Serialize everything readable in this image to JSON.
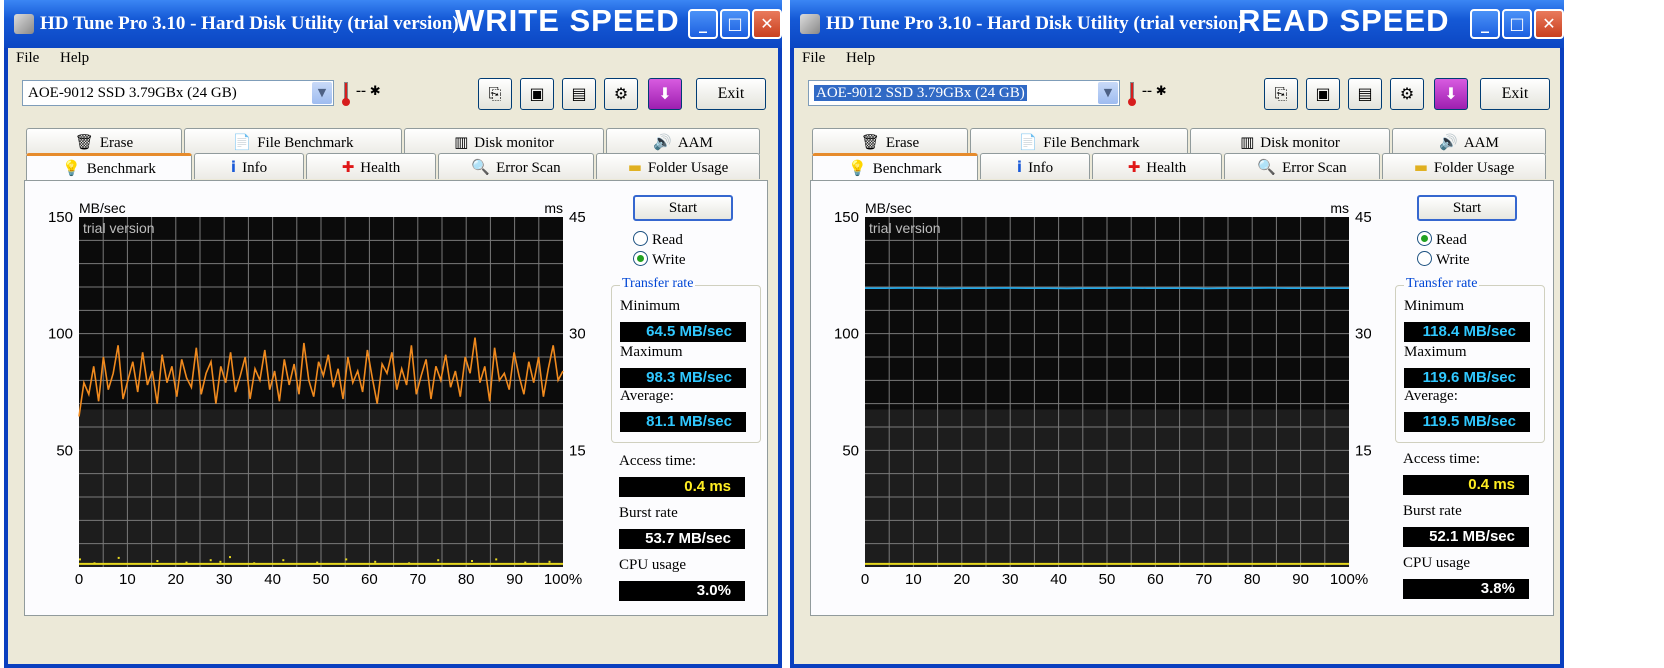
{
  "windows": [
    {
      "title": "HD Tune Pro 3.10 - Hard Disk Utility (trial version)",
      "overlay_label": "WRITE SPEED",
      "menu": [
        "File",
        "Help"
      ],
      "drive": "AOE-9012 SSD 3.79GBx (24 GB)",
      "temperature": "--",
      "exit_label": "Exit",
      "tabs_top": [
        "Erase",
        "File Benchmark",
        "Disk monitor",
        "AAM"
      ],
      "tabs_bottom": [
        "Benchmark",
        "Info",
        "Health",
        "Error Scan",
        "Folder Usage"
      ],
      "start_label": "Start",
      "radio_read": "Read",
      "radio_write": "Write",
      "selected_mode": "Write",
      "transfer_rate_title": "Transfer rate",
      "min_label": "Minimum",
      "min_value": "64.5 MB/sec",
      "max_label": "Maximum",
      "max_value": "98.3 MB/sec",
      "avg_label": "Average:",
      "avg_value": "81.1 MB/sec",
      "access_label": "Access time:",
      "access_value": "0.4 ms",
      "burst_label": "Burst rate",
      "burst_value": "53.7 MB/sec",
      "cpu_label": "CPU usage",
      "cpu_value": "3.0%"
    },
    {
      "title": "HD Tune Pro 3.10 - Hard Disk Utility (trial version)",
      "overlay_label": "READ SPEED",
      "menu": [
        "File",
        "Help"
      ],
      "drive": "AOE-9012 SSD 3.79GBx (24 GB)",
      "temperature": "--",
      "exit_label": "Exit",
      "tabs_top": [
        "Erase",
        "File Benchmark",
        "Disk monitor",
        "AAM"
      ],
      "tabs_bottom": [
        "Benchmark",
        "Info",
        "Health",
        "Error Scan",
        "Folder Usage"
      ],
      "start_label": "Start",
      "radio_read": "Read",
      "radio_write": "Write",
      "selected_mode": "Read",
      "transfer_rate_title": "Transfer rate",
      "min_label": "Minimum",
      "min_value": "118.4 MB/sec",
      "max_label": "Maximum",
      "max_value": "119.6 MB/sec",
      "avg_label": "Average:",
      "avg_value": "119.5 MB/sec",
      "access_label": "Access time:",
      "access_value": "0.4 ms",
      "burst_label": "Burst rate",
      "burst_value": "52.1 MB/sec",
      "cpu_label": "CPU usage",
      "cpu_value": "3.8%"
    }
  ],
  "chart_data": [
    {
      "type": "line",
      "watermark": "trial version",
      "ylabel": "MB/sec",
      "y2label": "ms",
      "ylim": [
        0,
        150
      ],
      "y2lim": [
        0,
        45
      ],
      "yticks": [
        50,
        100,
        150
      ],
      "y2ticks": [
        15,
        30,
        45
      ],
      "xticks": [
        "0",
        "10",
        "20",
        "30",
        "40",
        "50",
        "60",
        "70",
        "80",
        "90",
        "100%"
      ],
      "grid": true,
      "series": [
        {
          "values": [
            64.5,
            79,
            74,
            86,
            71,
            90,
            76,
            83,
            95,
            72,
            80,
            88,
            75,
            92,
            78,
            84,
            70,
            91,
            79,
            86,
            73,
            89,
            81,
            77,
            94,
            74,
            83,
            88,
            70,
            86,
            79,
            92,
            75,
            82,
            90,
            72,
            85,
            80,
            93,
            76,
            84,
            71,
            89,
            78,
            87,
            74,
            96,
            80,
            73,
            88,
            82,
            91,
            77,
            85,
            72,
            90,
            79,
            84,
            75,
            93,
            81,
            70,
            87,
            83,
            92,
            76,
            85,
            78,
            95,
            74,
            82,
            89,
            72,
            86,
            80,
            91,
            77,
            84,
            73,
            90,
            83,
            98.3,
            79,
            86,
            71,
            94,
            80,
            83,
            76,
            92,
            82,
            74,
            88,
            79,
            90,
            73,
            85,
            95,
            80,
            84
          ]
        },
        {
          "access_ms_points": [
            [
              0,
              1.1
            ],
            [
              3,
              0.6
            ],
            [
              8,
              1.3
            ],
            [
              16,
              0.9
            ],
            [
              22,
              0.7
            ],
            [
              27,
              1.0
            ],
            [
              29,
              0.8
            ],
            [
              31,
              1.4
            ],
            [
              36,
              0.6
            ],
            [
              42,
              1.0
            ],
            [
              49,
              0.7
            ],
            [
              55,
              1.1
            ],
            [
              61,
              0.8
            ],
            [
              68,
              0.6
            ],
            [
              74,
              1.0
            ],
            [
              81,
              0.9
            ],
            [
              86,
              1.1
            ],
            [
              92,
              0.7
            ],
            [
              97,
              0.8
            ]
          ]
        }
      ]
    },
    {
      "type": "line",
      "watermark": "trial version",
      "ylabel": "MB/sec",
      "y2label": "ms",
      "ylim": [
        0,
        150
      ],
      "y2lim": [
        0,
        45
      ],
      "yticks": [
        50,
        100,
        150
      ],
      "y2ticks": [
        15,
        30,
        45
      ],
      "xticks": [
        "0",
        "10",
        "20",
        "30",
        "40",
        "50",
        "60",
        "70",
        "80",
        "90",
        "100%"
      ],
      "grid": true,
      "series": [
        {
          "values": [
            119.5,
            119.5,
            119.6,
            119.5,
            119.4,
            119.5,
            119.5,
            119.6,
            119.5,
            119.5,
            119.4,
            119.5,
            119.5,
            119.6,
            119.5,
            119.5,
            119.5,
            119.4,
            119.5,
            119.5,
            119.6,
            119.5,
            119.5,
            119.5,
            119.5
          ]
        },
        {
          "access_ms_points": []
        }
      ]
    }
  ]
}
